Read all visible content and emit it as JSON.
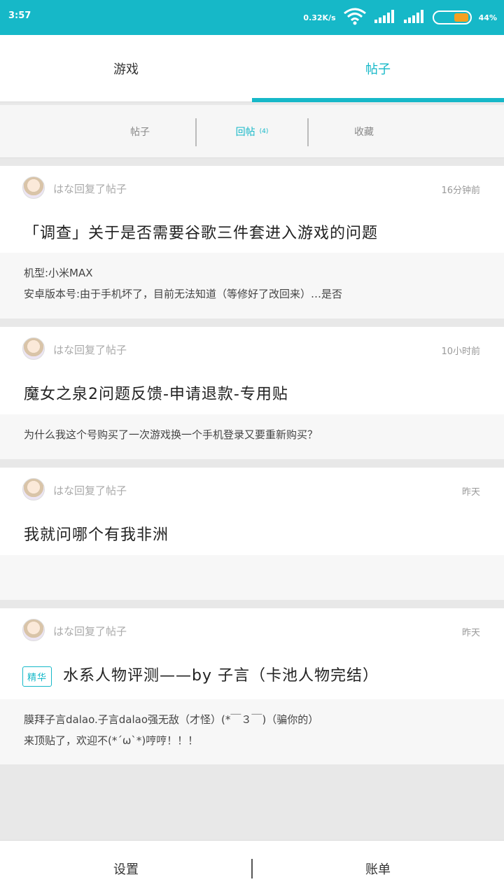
{
  "status_bar": {
    "time": "3:57",
    "net_speed": "0.32K/s",
    "battery_percent": "44%",
    "battery_level": 0.44,
    "icons": [
      "wifi-icon",
      "signal-icon",
      "signal-icon",
      "battery-icon"
    ]
  },
  "top_tabs": [
    {
      "label": "游戏",
      "active": false
    },
    {
      "label": "帖子",
      "active": true
    }
  ],
  "sub_tabs": {
    "posts": "帖子",
    "replies": "回帖",
    "replies_count": "(4)",
    "favorites": "收藏"
  },
  "posts": [
    {
      "meta": "はな回复了帖子",
      "time": "16分钟前",
      "title": "「调查」关于是否需要谷歌三件套进入游戏的问题",
      "body": [
        "机型:小米MAX",
        "安卓版本号:由于手机坏了，目前无法知道（等修好了改回来）…是否"
      ]
    },
    {
      "meta": "はな回复了帖子",
      "time": "10小时前",
      "title": "魔女之泉2问题反馈-申请退款-专用贴",
      "body": [
        "为什么我这个号购买了一次游戏换一个手机登录又要重新购买？"
      ]
    },
    {
      "meta": "はな回复了帖子",
      "time": "昨天",
      "title": "我就问哪个有我非洲",
      "body": []
    },
    {
      "meta": "はな回复了帖子",
      "time": "昨天",
      "badge": "精华",
      "title": "水系人物评测——by 子言（卡池人物完结）",
      "body": [
        "膜拜子言dalao.子言dalao强无敌（才怪）(*￣３￣)（骗你的）",
        "来顶贴了，欢迎不(*´ω`*)哼哼！！！"
      ]
    }
  ],
  "bottom_bar": {
    "settings": "设置",
    "bill": "账单"
  },
  "colors": {
    "accent": "#16b8c8",
    "battery": "#f5a020"
  }
}
